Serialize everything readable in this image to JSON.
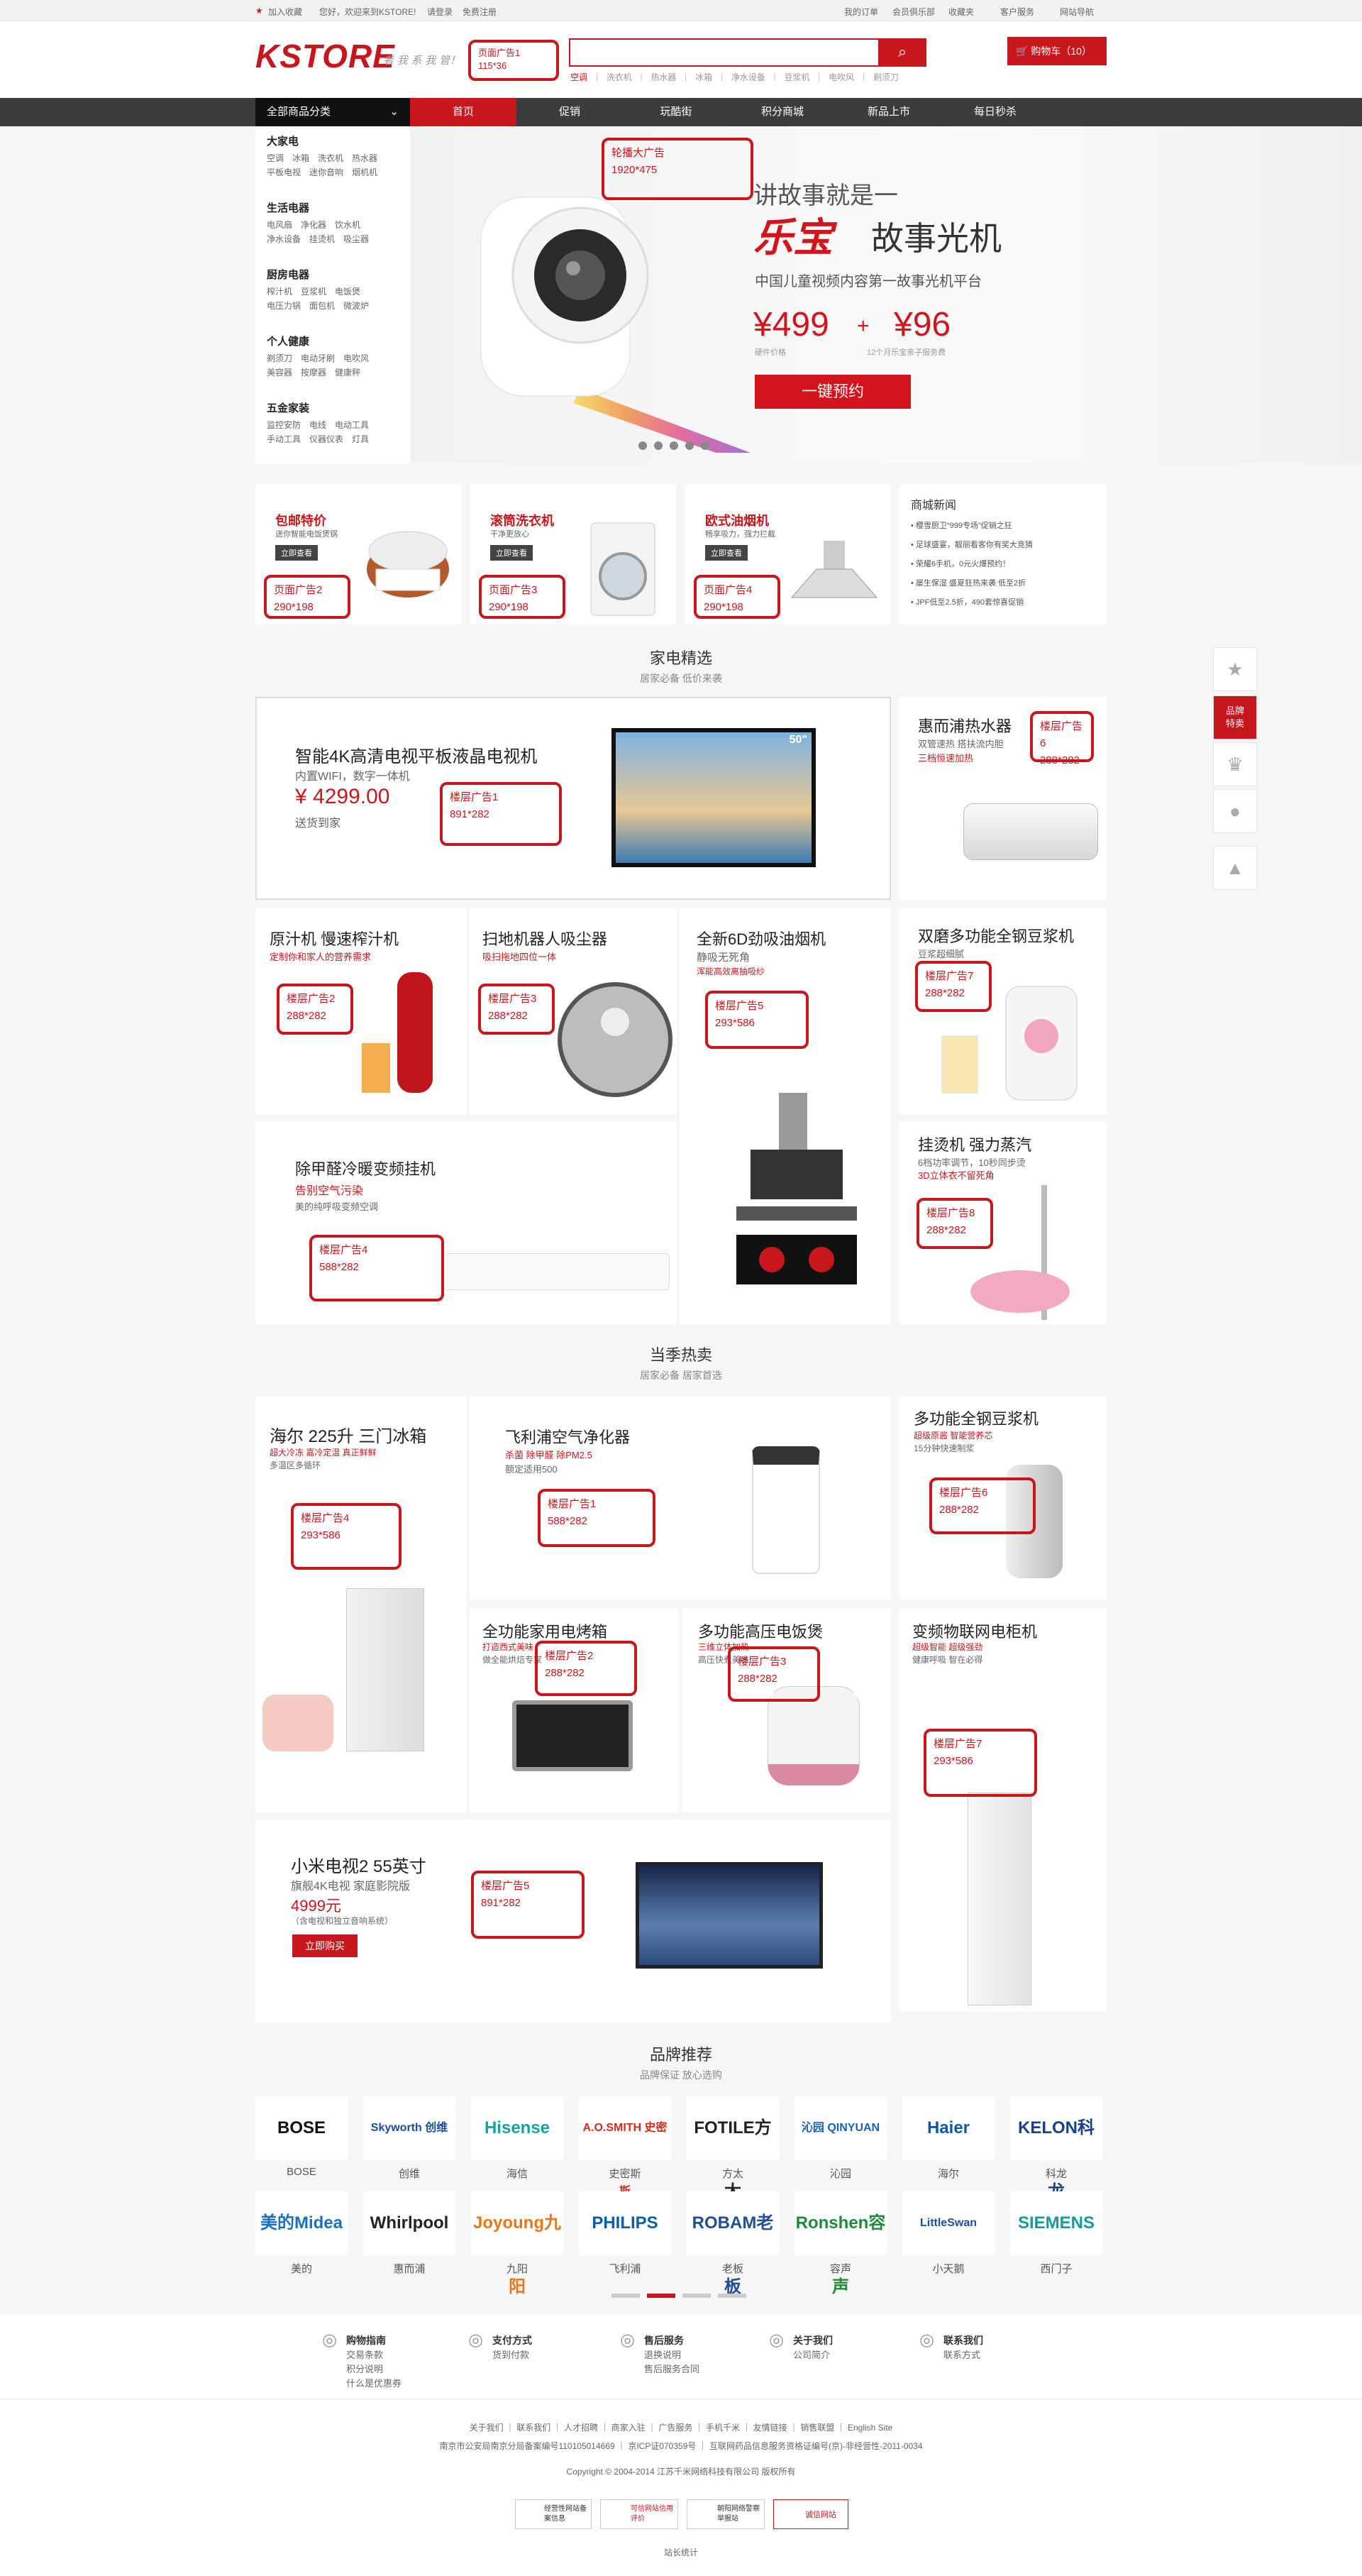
{
  "topbar": {
    "welcome": "加入收藏",
    "greeting": "您好，欢迎来到KSTORE!",
    "login": "请登录",
    "register": "免费注册",
    "right_links": [
      "我的订单",
      "会员俱乐部",
      "收藏夹",
      "客户服务",
      "网站导航"
    ]
  },
  "header": {
    "logo": "KSTORE",
    "slogan": "者 我 系 我 管！",
    "ad_label": "页面广告1\n115*36",
    "search_placeholder": "",
    "hot_keywords": [
      "空调",
      "洗衣机",
      "热水器",
      "冰箱",
      "净水设备",
      "豆浆机",
      "电吹风",
      "剃须刀"
    ],
    "cart": "购物车（10）"
  },
  "nav": {
    "all_categories": "全部商品分类",
    "items": [
      "首页",
      "促销",
      "玩酷街",
      "积分商城",
      "新品上市",
      "每日秒杀"
    ]
  },
  "categories": [
    {
      "title": "大家电",
      "items": "空调　冰箱　洗衣机　热水器\n平板电视　迷你音响　烟机机"
    },
    {
      "title": "生活电器",
      "items": "电风扇　净化器　饮水机\n净水设备　挂烫机　吸尘器"
    },
    {
      "title": "厨房电器",
      "items": "榨汁机　豆浆机　电饭煲\n电压力锅　面包机　微波炉"
    },
    {
      "title": "个人健康",
      "items": "剃须刀　电动牙刷　电吹风\n美容器　按摩器　健康秤"
    },
    {
      "title": "五金家装",
      "items": "监控安防　电线　电动工具\n手动工具　仪器仪表　灯具"
    }
  ],
  "banner": {
    "ad_label": "轮播大广告\n1920*475",
    "kicker": "讲故事就是一",
    "brand": "乐宝",
    "product": "故事光机",
    "desc": "中国儿童视频内容第一故事光机平台",
    "price1": "¥499",
    "price1_sub": "硬件价格",
    "plus": "+",
    "price2": "¥96",
    "price2_sub": "12个月乐宝亲子服务费",
    "cta": "一键预约",
    "dots": 5
  },
  "promos": [
    {
      "title": "包邮特价",
      "sub": "送你智能电饭煲锅",
      "btn": "立即查看",
      "ad": "页面广告2\n290*198"
    },
    {
      "title": "滚筒洗衣机",
      "sub": "干净更放心",
      "btn": "立即查看",
      "ad": "页面广告3\n290*198"
    },
    {
      "title": "欧式油烟机",
      "sub": "畅享吸力，强力拦截",
      "btn": "立即查看",
      "ad": "页面广告4\n290*198"
    }
  ],
  "news": {
    "title": "商城新闻",
    "items": [
      "樱雪厨卫“999专场”促销之狂",
      "足球盛宴，靓丽看客你有奖大竞猜",
      "荣耀6手机，0元火爆预约！",
      "屡生保湿 盛夏狂热来袭 低至2折",
      "JPF低至2.5折，490套惊喜促销"
    ]
  },
  "section1": {
    "title": "家电精选",
    "sub": "居家必备 低价来袭",
    "cards": [
      {
        "title": "智能4K高清电视平板液晶电视机",
        "sub": "内置WIFI，数字一体机",
        "price": "¥ 4299.00",
        "sub2": "送货到家",
        "ad": "楼层广告1\n891*282",
        "badge": "50\""
      },
      {
        "title": "惠而浦热水器",
        "sub": "双管速热 搭扶流内胆",
        "sub2": "三档恒速加热",
        "ad": "楼层广告6\n288*282"
      },
      {
        "title": "原汁机 慢速榨汁机",
        "sub": "定制你和家人的营养需求",
        "ad": "楼层广告2\n288*282"
      },
      {
        "title": "扫地机器人吸尘器",
        "sub": "吸扫拖地四位一体",
        "ad": "楼层广告3\n288*282"
      },
      {
        "title": "全新6D劲吸油烟机",
        "sub": "静吸无死角",
        "sub2": "浑能高效离抽吸纱",
        "ad": "楼层广告5\n293*586"
      },
      {
        "title": "双磨多功能全钢豆浆机",
        "sub": "豆浆超细腻",
        "ad": "楼层广告7\n288*282"
      },
      {
        "title": "除甲醛冷暖变频挂机",
        "sub": "告别空气污染",
        "sub2": "美的纯呼吸变频空调",
        "ad": "楼层广告4\n588*282"
      },
      {
        "title": "挂烫机 强力蒸汽",
        "sub": "6档功率调节，10秒同步烫",
        "sub2": "3D立体衣不留死角",
        "ad": "楼层广告8\n288*282"
      }
    ]
  },
  "section2": {
    "title": "当季热卖",
    "sub": "居家必备 居家首选",
    "cards": [
      {
        "title": "海尔 225升 三门冰箱",
        "sub": "超大冷冻 嘉冷定温 真正鲜鲜",
        "sub2": "多温区多循环",
        "ad": "楼层广告4\n293*586"
      },
      {
        "title": "飞利浦空气净化器",
        "sub": "杀菌 除甲醛 除PM2.5",
        "sub2": "额定适用500",
        "ad": "楼层广告1\n588*282"
      },
      {
        "title": "多功能全钢豆浆机",
        "sub": "超级原酱 智能营养芯",
        "sub2": "15分钟快速制浆",
        "ad": "楼层广告6\n288*282"
      },
      {
        "title": "全功能家用电烤箱",
        "sub": "打造西式美味",
        "sub2": "做全能烘焙专家",
        "ad": "楼层广告2\n288*282"
      },
      {
        "title": "多功能高压电饭煲",
        "sub": "三维立体加热",
        "sub2": "高压快煮美味",
        "ad": "楼层广告3\n288*282"
      },
      {
        "title": "变频物联网电柜机",
        "sub": "超级智能 超级强劲",
        "sub2": "健康呼吸 智在必得",
        "ad": "楼层广告7\n293*586"
      },
      {
        "title": "小米电视2 55英寸",
        "sub": "旗舰4K电视 家庭影院版",
        "price": "4999元",
        "sub2": "（含电视和独立音响系统）",
        "btn": "立即购买",
        "ad": "楼层广告5\n891*282"
      }
    ]
  },
  "brands": {
    "title": "品牌推荐",
    "sub": "品牌保证 放心选购",
    "items": [
      {
        "logo": "BOSE",
        "name": "BOSE",
        "color": "#111111"
      },
      {
        "logo": "Skyworth 创维",
        "name": "创维",
        "color": "#1a4fa0"
      },
      {
        "logo": "Hisense",
        "name": "海信",
        "color": "#14a3a3"
      },
      {
        "logo": "A.O.SMITH 史密斯",
        "name": "史密斯",
        "color": "#d12c1f"
      },
      {
        "logo": "FOTILE方太",
        "name": "方太",
        "color": "#222222"
      },
      {
        "logo": "沁园 QINYUAN",
        "name": "沁园",
        "color": "#1a62b4"
      },
      {
        "logo": "Haier",
        "name": "海尔",
        "color": "#1256a8"
      },
      {
        "logo": "KELON科龙",
        "name": "科龙",
        "color": "#1b3f8f"
      },
      {
        "logo": "美的Midea",
        "name": "美的",
        "color": "#1a6fc2"
      },
      {
        "logo": "Whirlpool",
        "name": "惠而浦",
        "color": "#222222"
      },
      {
        "logo": "Joyoung九阳",
        "name": "九阳",
        "color": "#e7771b"
      },
      {
        "logo": "PHILIPS",
        "name": "飞利浦",
        "color": "#0b5ea8"
      },
      {
        "logo": "ROBAM老板",
        "name": "老板",
        "color": "#1f4f97"
      },
      {
        "logo": "Ronshen容声",
        "name": "容声",
        "color": "#1d8b3b"
      },
      {
        "logo": "LittleSwan",
        "name": "小天鹅",
        "color": "#1b4fa0"
      },
      {
        "logo": "SIEMENS",
        "name": "西门子",
        "color": "#149b9b"
      }
    ]
  },
  "footer": {
    "cols": [
      {
        "title": "购物指南",
        "items": [
          "交易条款",
          "积分说明",
          "什么是优惠券"
        ]
      },
      {
        "title": "支付方式",
        "items": [
          "货到付款"
        ]
      },
      {
        "title": "售后服务",
        "items": [
          "退换说明",
          "售后服务合同"
        ]
      },
      {
        "title": "关于我们",
        "items": [
          "公司简介"
        ]
      },
      {
        "title": "联系我们",
        "items": [
          "联系方式"
        ]
      }
    ],
    "links": "关于我们 ｜ 联系我们 ｜ 人才招聘 ｜ 商家入驻 ｜ 广告服务 ｜ 手机千米 ｜ 友情链接 ｜ 销售联盟 ｜ English Site",
    "icp": "南京市公安局南京分局备案编号110105014669 ｜ 京ICP证070359号 ｜ 互联网药品信息服务资格证编号(京)-非经营性-2011-0034",
    "copyright": "Copyright © 2004-2014  江苏千米网络科技有限公司 版权所有",
    "badges": [
      "经营性网站备案信息",
      "可信网站信用评价",
      "朝阳网络警察举报站",
      "诚信网站"
    ],
    "stats": "站长统计"
  },
  "sidebar": {
    "items": [
      "★",
      "品牌\n特卖",
      "♛",
      "●",
      "▲"
    ]
  }
}
